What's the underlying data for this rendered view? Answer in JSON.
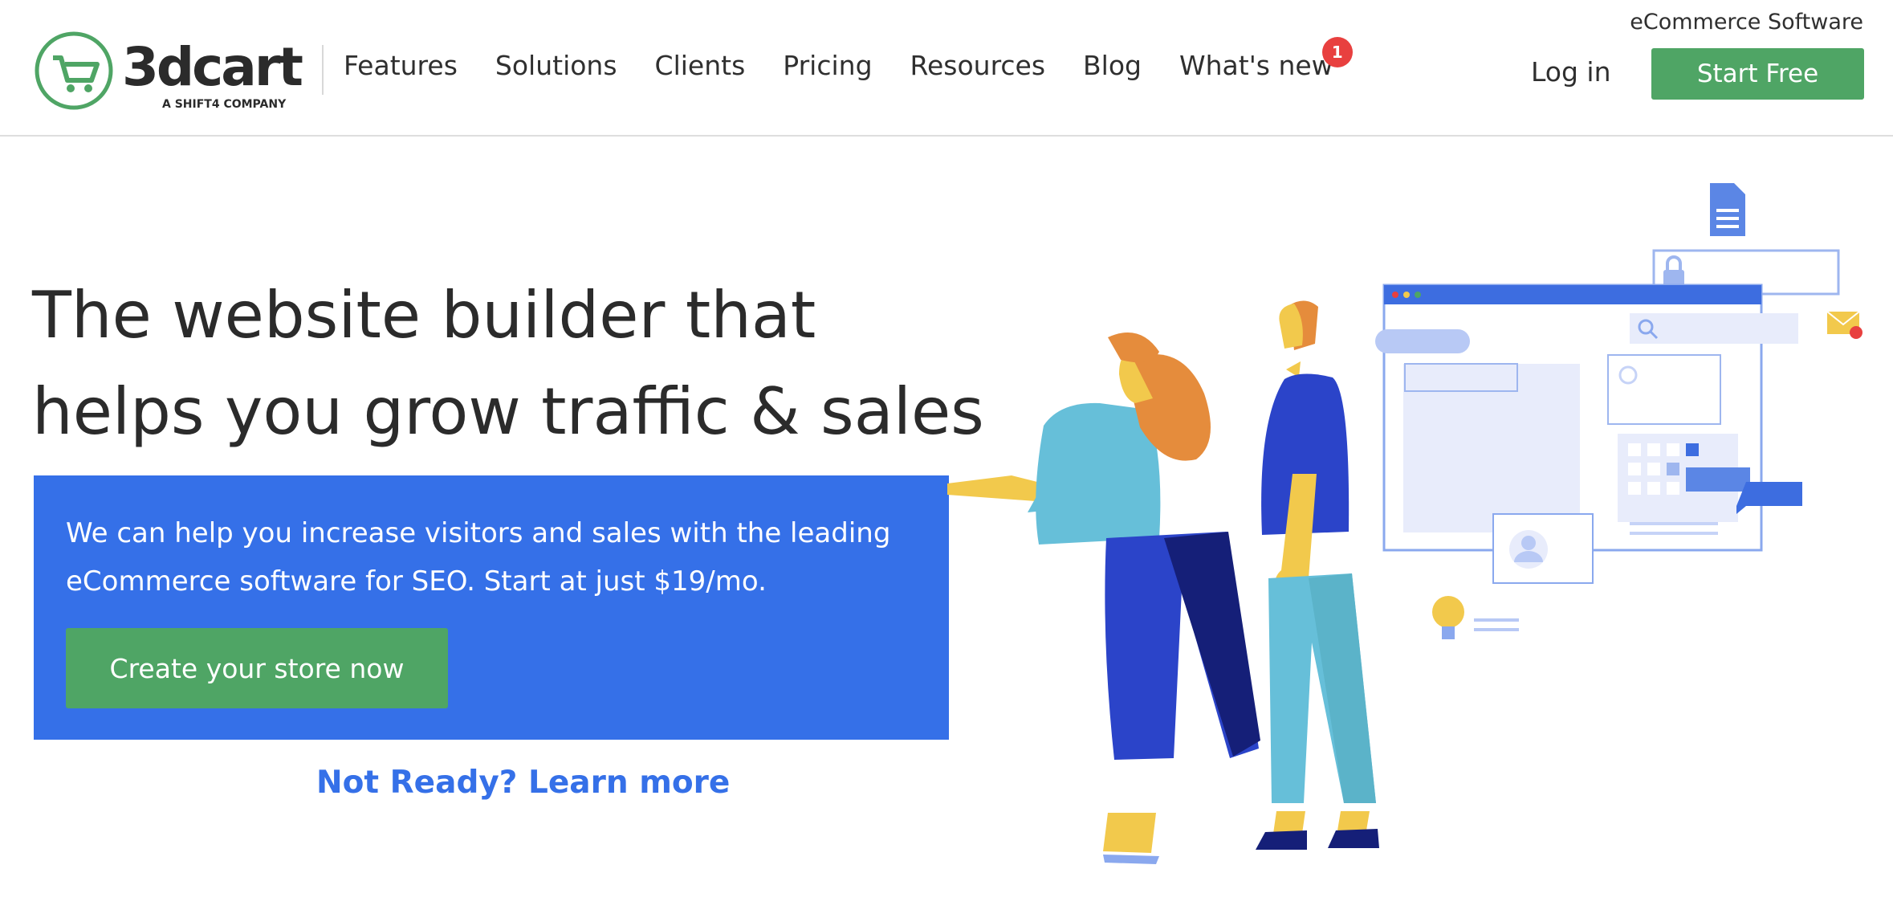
{
  "header": {
    "logo_text": "3dcart",
    "logo_subtext": "A SHIFT4 COMPANY",
    "tagline": "eCommerce Software",
    "nav": [
      {
        "label": "Features"
      },
      {
        "label": "Solutions"
      },
      {
        "label": "Clients"
      },
      {
        "label": "Pricing"
      },
      {
        "label": "Resources"
      },
      {
        "label": "Blog"
      },
      {
        "label": "What's new",
        "badge": "1"
      }
    ],
    "login_label": "Log in",
    "start_free_label": "Start Free"
  },
  "hero": {
    "title_line1": "The website builder that",
    "title_line2": "helps you grow traffic & sales",
    "description": "We can help you increase visitors and sales with the leading eCommerce software for SEO. Start at just $19/mo.",
    "cta_label": "Create your store now",
    "learn_more_label": "Not Ready? Learn more"
  },
  "colors": {
    "brand_green": "#4fa565",
    "brand_blue": "#3570e8",
    "badge_red": "#e8403f"
  },
  "icons": [
    "cart-logo-icon",
    "notification-badge",
    "document-icon",
    "lock-icon",
    "search-icon",
    "mail-icon",
    "lightbulb-icon",
    "user-avatar-icon"
  ]
}
